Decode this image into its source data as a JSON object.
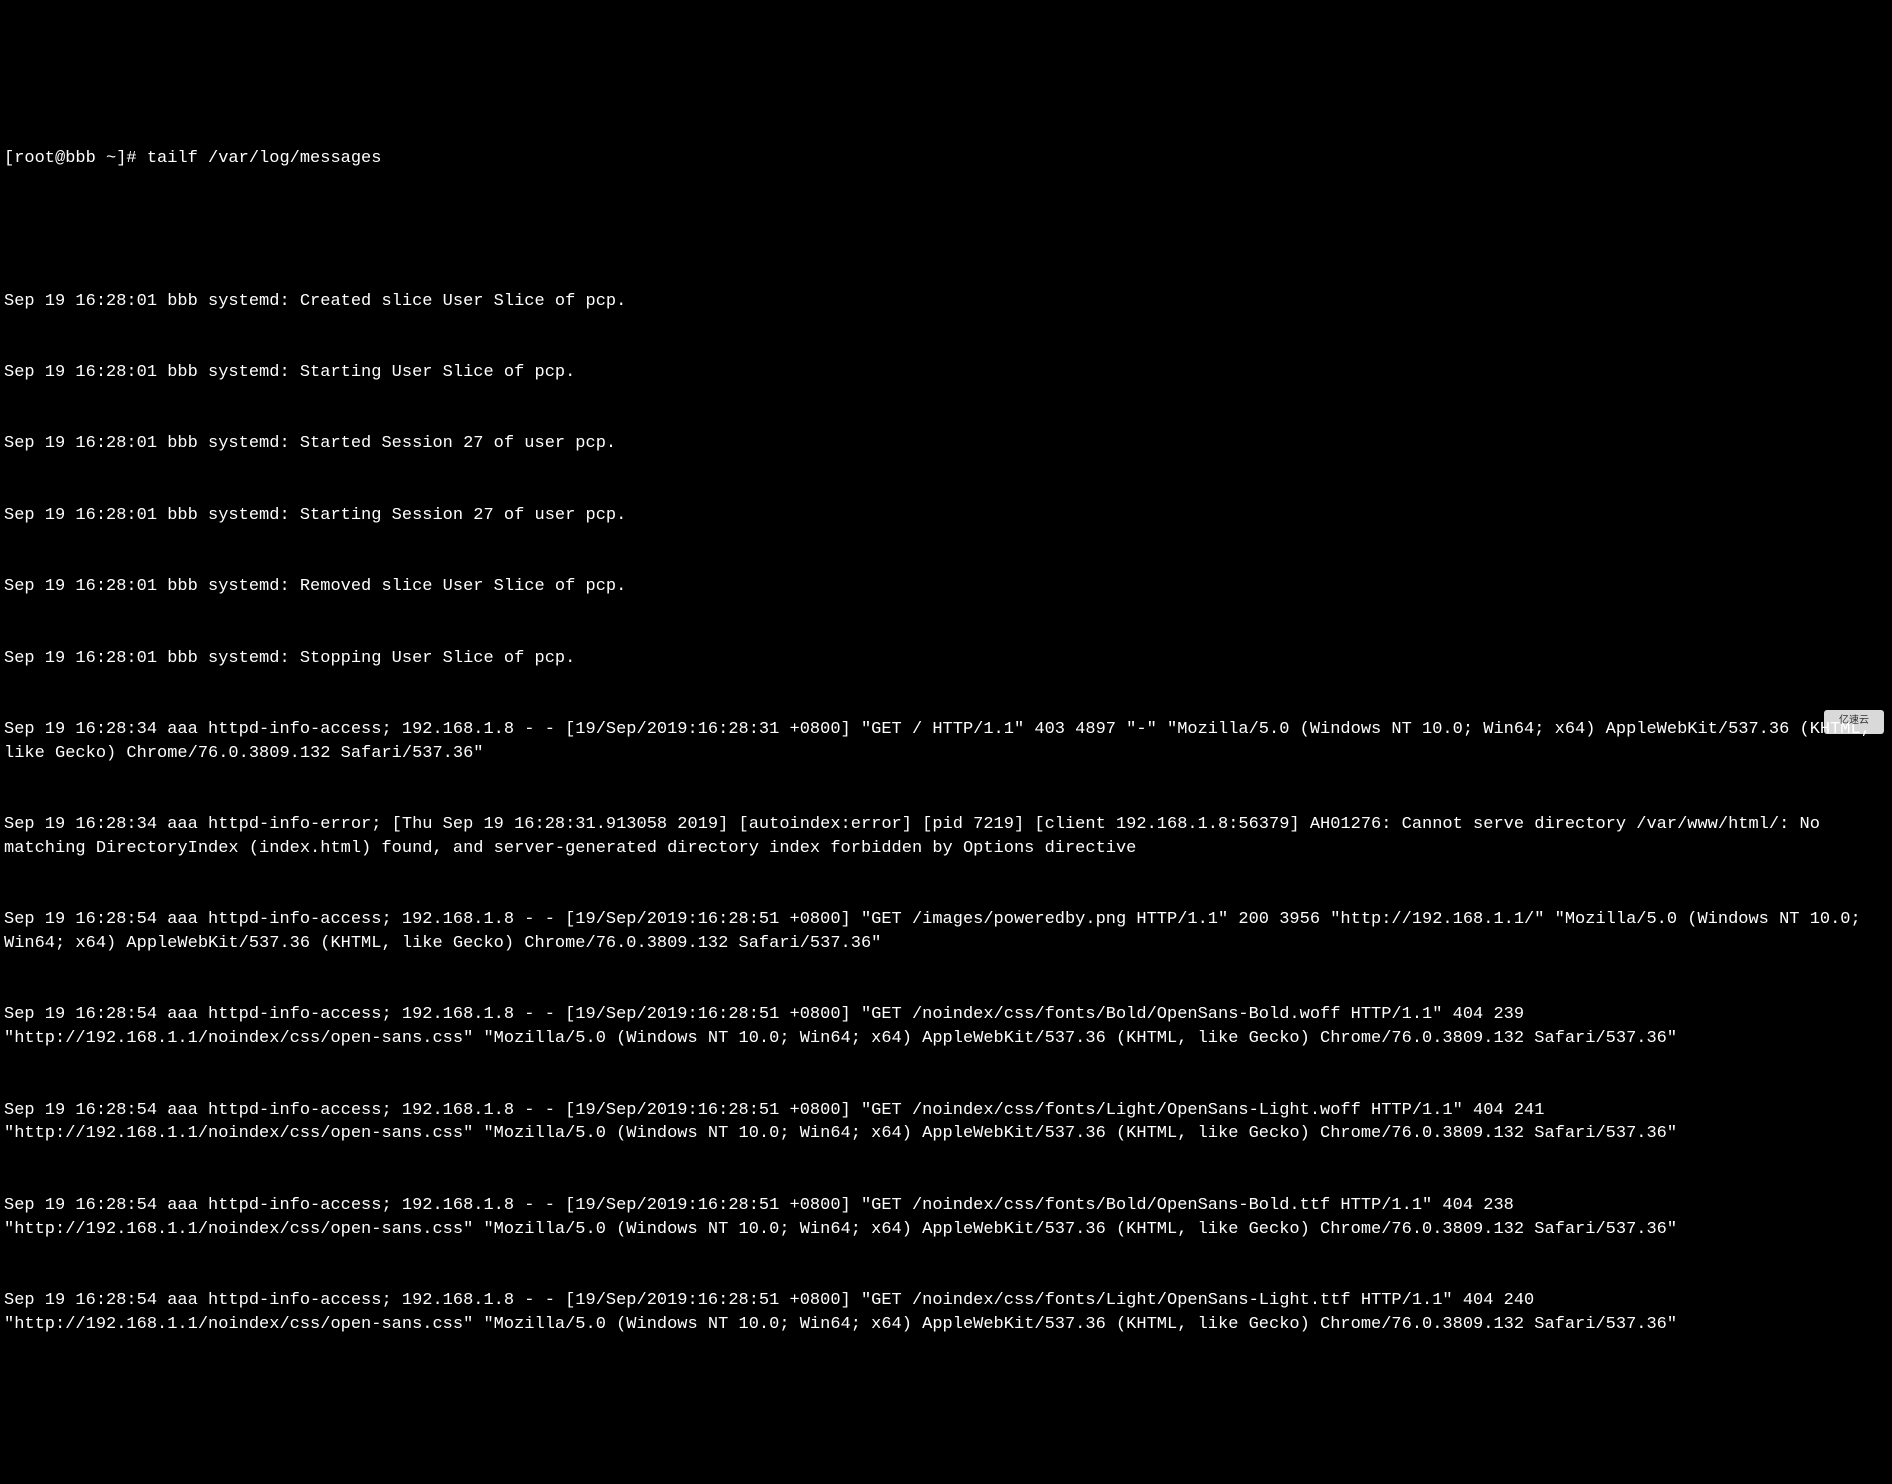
{
  "terminal": {
    "prompt": "[root@bbb ~]# tailf /var/log/messages",
    "log_lines": [
      "Sep 19 16:28:01 bbb systemd: Created slice User Slice of pcp.",
      "Sep 19 16:28:01 bbb systemd: Starting User Slice of pcp.",
      "Sep 19 16:28:01 bbb systemd: Started Session 27 of user pcp.",
      "Sep 19 16:28:01 bbb systemd: Starting Session 27 of user pcp.",
      "Sep 19 16:28:01 bbb systemd: Removed slice User Slice of pcp.",
      "Sep 19 16:28:01 bbb systemd: Stopping User Slice of pcp.",
      "Sep 19 16:28:34 aaa httpd-info-access; 192.168.1.8 - - [19/Sep/2019:16:28:31 +0800] \"GET / HTTP/1.1\" 403 4897 \"-\" \"Mozilla/5.0 (Windows NT 10.0; Win64; x64) AppleWebKit/537.36 (KHTML, like Gecko) Chrome/76.0.3809.132 Safari/537.36\"",
      "Sep 19 16:28:34 aaa httpd-info-error; [Thu Sep 19 16:28:31.913058 2019] [autoindex:error] [pid 7219] [client 192.168.1.8:56379] AH01276: Cannot serve directory /var/www/html/: No matching DirectoryIndex (index.html) found, and server-generated directory index forbidden by Options directive",
      "Sep 19 16:28:54 aaa httpd-info-access; 192.168.1.8 - - [19/Sep/2019:16:28:51 +0800] \"GET /images/poweredby.png HTTP/1.1\" 200 3956 \"http://192.168.1.1/\" \"Mozilla/5.0 (Windows NT 10.0; Win64; x64) AppleWebKit/537.36 (KHTML, like Gecko) Chrome/76.0.3809.132 Safari/537.36\"",
      "Sep 19 16:28:54 aaa httpd-info-access; 192.168.1.8 - - [19/Sep/2019:16:28:51 +0800] \"GET /noindex/css/fonts/Bold/OpenSans-Bold.woff HTTP/1.1\" 404 239 \"http://192.168.1.1/noindex/css/open-sans.css\" \"Mozilla/5.0 (Windows NT 10.0; Win64; x64) AppleWebKit/537.36 (KHTML, like Gecko) Chrome/76.0.3809.132 Safari/537.36\"",
      "Sep 19 16:28:54 aaa httpd-info-access; 192.168.1.8 - - [19/Sep/2019:16:28:51 +0800] \"GET /noindex/css/fonts/Light/OpenSans-Light.woff HTTP/1.1\" 404 241 \"http://192.168.1.1/noindex/css/open-sans.css\" \"Mozilla/5.0 (Windows NT 10.0; Win64; x64) AppleWebKit/537.36 (KHTML, like Gecko) Chrome/76.0.3809.132 Safari/537.36\"",
      "Sep 19 16:28:54 aaa httpd-info-access; 192.168.1.8 - - [19/Sep/2019:16:28:51 +0800] \"GET /noindex/css/fonts/Bold/OpenSans-Bold.ttf HTTP/1.1\" 404 238 \"http://192.168.1.1/noindex/css/open-sans.css\" \"Mozilla/5.0 (Windows NT 10.0; Win64; x64) AppleWebKit/537.36 (KHTML, like Gecko) Chrome/76.0.3809.132 Safari/537.36\"",
      "Sep 19 16:28:54 aaa httpd-info-access; 192.168.1.8 - - [19/Sep/2019:16:28:51 +0800] \"GET /noindex/css/fonts/Light/OpenSans-Light.ttf HTTP/1.1\" 404 240 \"http://192.168.1.1/noindex/css/open-sans.css\" \"Mozilla/5.0 (Windows NT 10.0; Win64; x64) AppleWebKit/537.36 (KHTML, like Gecko) Chrome/76.0.3809.132 Safari/537.36\""
    ],
    "watermark": "亿速云"
  }
}
